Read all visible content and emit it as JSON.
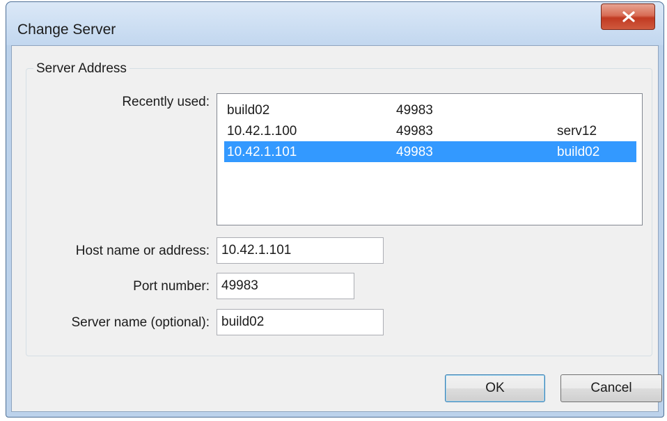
{
  "window": {
    "title": "Change Server"
  },
  "group": {
    "title": "Server Address"
  },
  "recent": {
    "label": "Recently used:",
    "rows": [
      {
        "host": "build02",
        "port": "49983",
        "name": ""
      },
      {
        "host": "10.42.1.100",
        "port": "49983",
        "name": "serv12"
      },
      {
        "host": "10.42.1.101",
        "port": "49983",
        "name": "build02",
        "selected": true
      }
    ]
  },
  "host": {
    "label": "Host name or address:",
    "value": "10.42.1.101"
  },
  "port": {
    "label": "Port number:",
    "value": "49983"
  },
  "server_name": {
    "label": "Server name (optional):",
    "value": "build02"
  },
  "buttons": {
    "ok": "OK",
    "cancel": "Cancel"
  },
  "colors": {
    "selection": "#3399ff",
    "close_button": "#c13a22"
  },
  "icons": {
    "close": "close-icon"
  }
}
